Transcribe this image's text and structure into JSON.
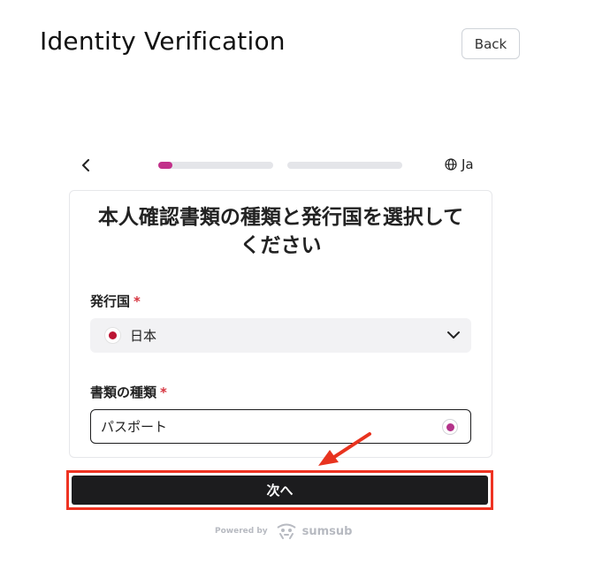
{
  "header": {
    "title": "Identity Verification",
    "back_label": "Back"
  },
  "stepper": {
    "steps": [
      {
        "progress": 0.12
      },
      {
        "progress": 0.0
      }
    ],
    "language_label": "Ja",
    "accent_color": "#c2318a"
  },
  "form": {
    "title_line1": "本人確認書類の種類と発行国を選択して",
    "title_line2": "ください",
    "country_label": "発行国",
    "country_required": "*",
    "country_value": "日本",
    "doc_type_label": "書類の種類",
    "doc_type_required": "*",
    "doc_type_value": "パスポート"
  },
  "footer": {
    "next_label": "次へ",
    "powered_by": "Powered by",
    "brand": "sumsub"
  },
  "icons": {
    "back": "chevron-left-icon",
    "language": "globe-icon",
    "select": "chevron-down-icon",
    "flag": "japan-flag-icon",
    "annotation": "red-arrow-icon",
    "brand": "sumsub-logo-icon"
  }
}
